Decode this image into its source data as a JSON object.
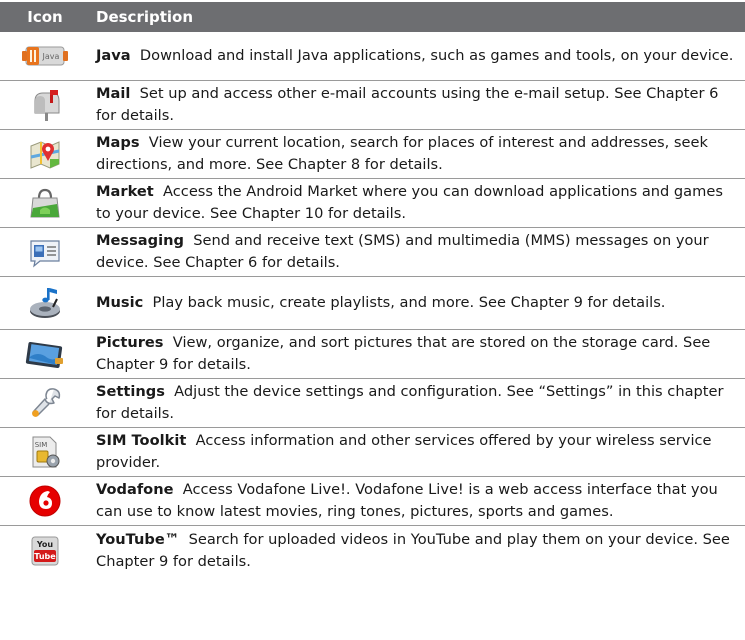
{
  "header": {
    "icon_col": "Icon",
    "desc_col": "Description"
  },
  "rows": [
    {
      "name": "Java",
      "text": "Download and install Java applications, such as games and tools, on your device.",
      "icon": "java-icon",
      "icon_text": "Java"
    },
    {
      "name": "Mail",
      "text": "Set up and access other e-mail accounts using the e-mail setup. See Chapter 6 for details.",
      "icon": "mailbox-icon"
    },
    {
      "name": "Maps",
      "text": "View your current location, search for places of interest and addresses, seek directions, and more. See Chapter 8 for details.",
      "icon": "map-icon"
    },
    {
      "name": "Market",
      "text": "Access the Android Market where you can download applications and games to your device. See Chapter 10 for details.",
      "icon": "shopping-bag-icon"
    },
    {
      "name": "Messaging",
      "text": "Send and receive text (SMS) and multimedia (MMS) messages on your device. See Chapter 6 for details.",
      "icon": "message-bubble-icon"
    },
    {
      "name": "Music",
      "text": "Play back music, create playlists, and more. See Chapter 9 for details.",
      "icon": "music-icon"
    },
    {
      "name": "Pictures",
      "text": "View, organize, and sort pictures that are stored on the storage card. See Chapter 9 for details.",
      "icon": "pictures-icon"
    },
    {
      "name": "Settings",
      "text": "Adjust the device settings and configuration. See “Settings” in this chapter for details.",
      "icon": "wrench-icon"
    },
    {
      "name": "SIM Toolkit",
      "text": "Access information and other services offered by your wireless service provider.",
      "icon": "sim-card-icon",
      "icon_text": "SIM"
    },
    {
      "name": "Vodafone",
      "text": "Access Vodafone Live!. Vodafone Live! is a web access interface that you can use to know latest movies, ring tones, pictures, sports and games.",
      "icon": "vodafone-icon"
    },
    {
      "name": "YouTube™",
      "text": "Search for uploaded videos in YouTube and play them on your device. See Chapter 9 for details.",
      "icon": "youtube-icon",
      "icon_text": [
        "You",
        "Tube"
      ]
    }
  ]
}
